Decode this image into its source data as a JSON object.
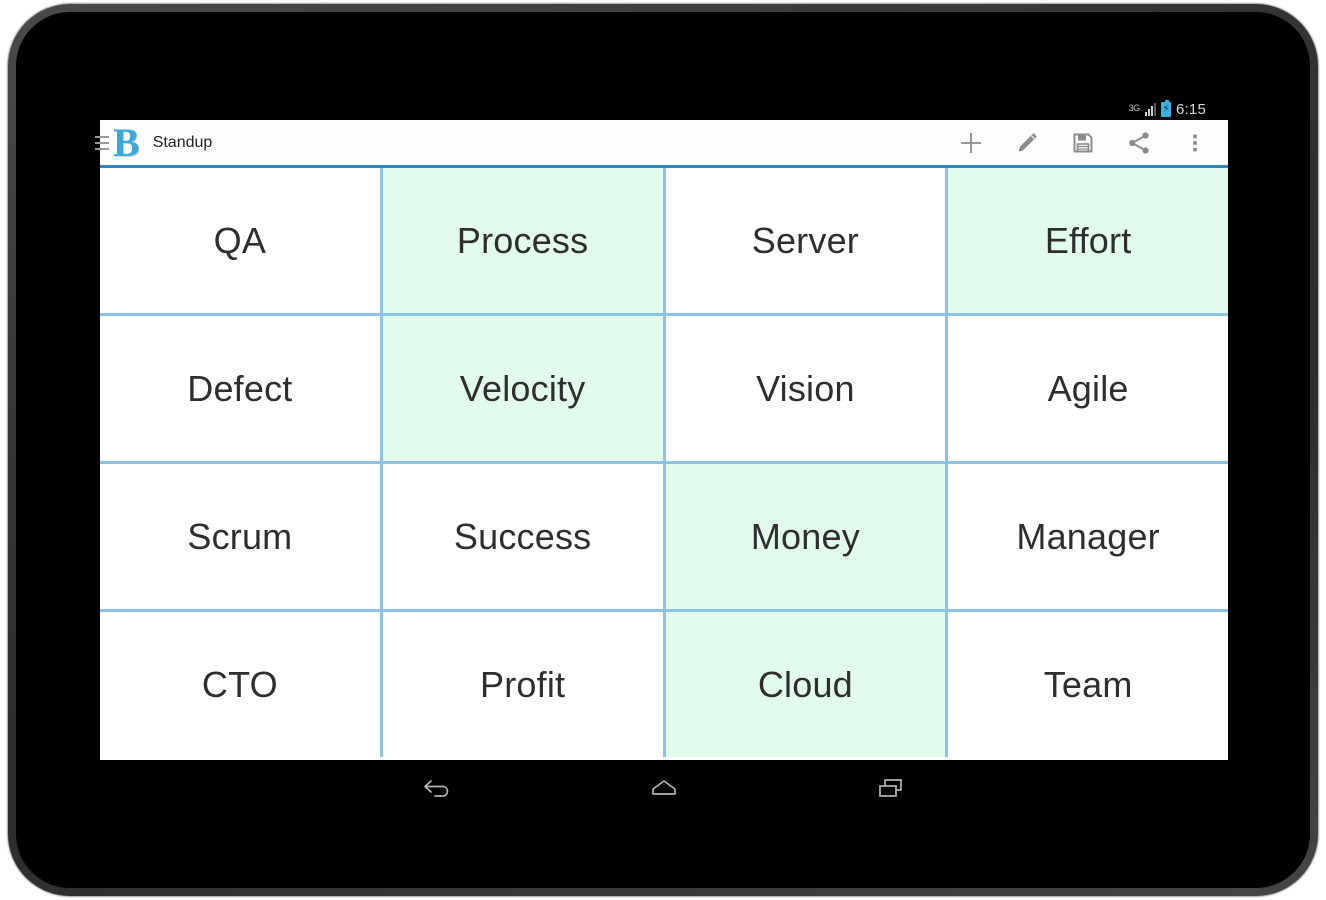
{
  "device": {
    "kind": "android-tablet",
    "bezel_color": "#3c3c3c",
    "screen_color": "#000000"
  },
  "status_bar": {
    "network_label": "3G",
    "signal_icon": "signal-bars-icon",
    "battery_icon": "battery-charging-icon",
    "battery_bolt": "⚡",
    "clock": "6:15"
  },
  "action_bar": {
    "drawer_icon": "hamburger-menu-icon",
    "logo_letter": "B",
    "title": "Standup",
    "accent_color": "#3aa8dc",
    "divider_color": "#2b86c4",
    "actions": [
      {
        "name": "add-button",
        "icon": "plus-icon",
        "label": "Add"
      },
      {
        "name": "edit-button",
        "icon": "pencil-icon",
        "label": "Edit"
      },
      {
        "name": "save-button",
        "icon": "floppy-disk-icon",
        "label": "Save"
      },
      {
        "name": "share-button",
        "icon": "share-icon",
        "label": "Share"
      },
      {
        "name": "overflow-button",
        "icon": "more-vertical-icon",
        "label": "More options"
      }
    ]
  },
  "grid": {
    "columns": 4,
    "rows": 4,
    "cell_bg": "#ffffff",
    "cell_selected_bg": "#e1fbec",
    "border_color": "#8cc3e2",
    "text_color": "#2e2e2e",
    "cells": [
      {
        "label": "QA",
        "selected": false
      },
      {
        "label": "Process",
        "selected": true
      },
      {
        "label": "Server",
        "selected": false
      },
      {
        "label": "Effort",
        "selected": true
      },
      {
        "label": "Defect",
        "selected": false
      },
      {
        "label": "Velocity",
        "selected": true
      },
      {
        "label": "Vision",
        "selected": false
      },
      {
        "label": "Agile",
        "selected": false
      },
      {
        "label": "Scrum",
        "selected": false
      },
      {
        "label": "Success",
        "selected": false
      },
      {
        "label": "Money",
        "selected": true
      },
      {
        "label": "Manager",
        "selected": false
      },
      {
        "label": "CTO",
        "selected": false
      },
      {
        "label": "Profit",
        "selected": false
      },
      {
        "label": "Cloud",
        "selected": true
      },
      {
        "label": "Team",
        "selected": false
      }
    ]
  },
  "nav_bar": {
    "buttons": [
      {
        "name": "nav-back-button",
        "icon": "back-arrow-icon",
        "label": "Back"
      },
      {
        "name": "nav-home-button",
        "icon": "home-icon",
        "label": "Home"
      },
      {
        "name": "nav-recents-button",
        "icon": "recent-apps-icon",
        "label": "Recent apps"
      }
    ]
  }
}
